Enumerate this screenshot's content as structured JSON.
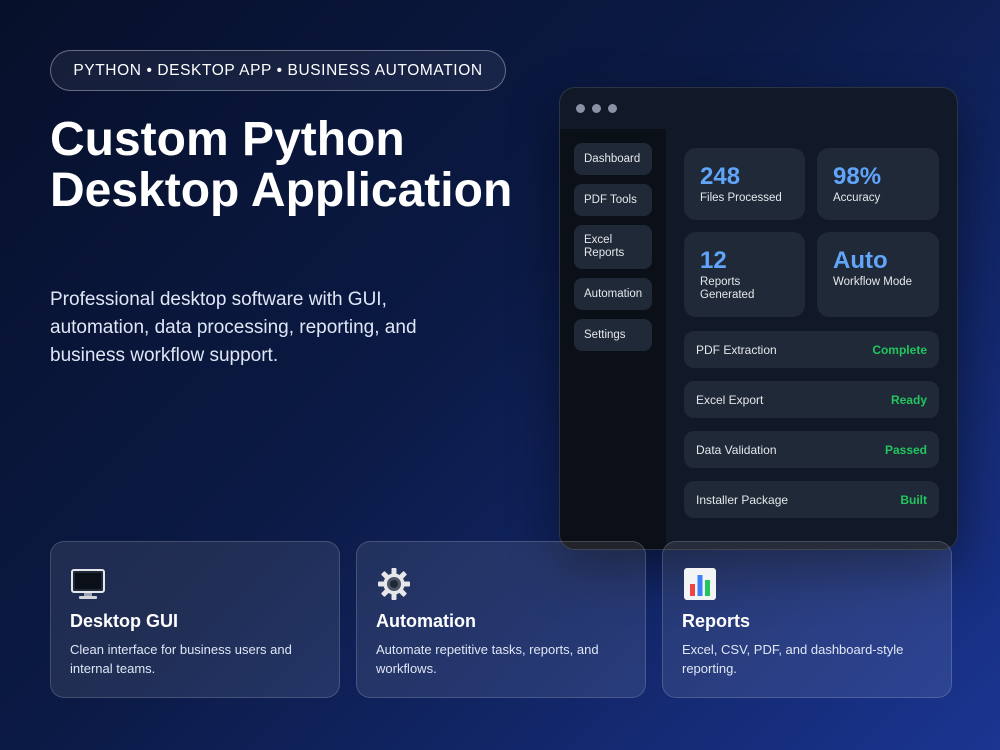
{
  "header": {
    "tagline": "PYTHON • DESKTOP APP • BUSINESS AUTOMATION",
    "title": "Custom Python Desktop Application",
    "subtitle": "Professional desktop software with GUI, automation, data processing, reporting, and business workflow support."
  },
  "app_window": {
    "sidebar": {
      "items": [
        {
          "label": "Dashboard"
        },
        {
          "label": "PDF Tools"
        },
        {
          "label": "Excel Reports"
        },
        {
          "label": "Automation"
        },
        {
          "label": "Settings"
        }
      ]
    },
    "stats": [
      {
        "value": "248",
        "label": "Files Processed"
      },
      {
        "value": "98%",
        "label": "Accuracy"
      },
      {
        "value": "12",
        "label": "Reports Generated"
      },
      {
        "value": "Auto",
        "label": "Workflow Mode"
      }
    ],
    "tasks": [
      {
        "label": "PDF Extraction",
        "status": "Complete"
      },
      {
        "label": "Excel Export",
        "status": "Ready"
      },
      {
        "label": "Data Validation",
        "status": "Passed"
      },
      {
        "label": "Installer Package",
        "status": "Built"
      }
    ]
  },
  "features": [
    {
      "icon": "monitor-icon",
      "title": "Desktop GUI",
      "description": "Clean interface for business users and internal teams."
    },
    {
      "icon": "gear-icon",
      "title": "Automation",
      "description": "Automate repetitive tasks, reports, and workflows."
    },
    {
      "icon": "bar-chart-icon",
      "title": "Reports",
      "description": "Excel, CSV, PDF, and dashboard-style reporting."
    }
  ],
  "colors": {
    "accent_blue": "#60a5fa",
    "status_green": "#22c55e",
    "panel": "#1f2937",
    "window_bg": "#111827"
  }
}
